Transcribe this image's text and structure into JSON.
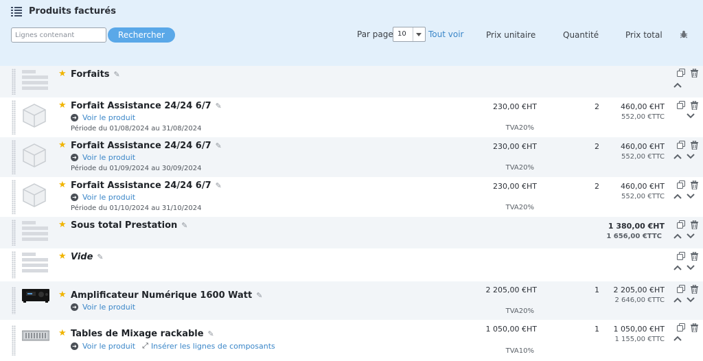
{
  "header": {
    "title": "Produits facturés",
    "search_placeholder": "Lignes contenant",
    "search_button": "Rechercher",
    "per_page_label": "Par page",
    "per_page_value": "10",
    "show_all": "Tout voir",
    "columns": {
      "unit_price": "Prix unitaire",
      "quantity": "Quantité",
      "total": "Prix total"
    }
  },
  "rows": [
    {
      "name": "Forfaits"
    },
    {
      "name": "Forfait Assistance 24/24 6/7",
      "link": "Voir le produit",
      "period": "Période du 01/08/2024 au 31/08/2024",
      "unit_price": "230,00 €HT",
      "tva": "TVA20%",
      "qty": "2",
      "total_ht": "460,00 €HT",
      "total_ttc": "552,00 €TTC"
    },
    {
      "name": "Forfait Assistance 24/24 6/7",
      "link": "Voir le produit",
      "period": "Période du 01/09/2024 au 30/09/2024",
      "unit_price": "230,00 €HT",
      "tva": "TVA20%",
      "qty": "2",
      "total_ht": "460,00 €HT",
      "total_ttc": "552,00 €TTC"
    },
    {
      "name": "Forfait Assistance 24/24 6/7",
      "link": "Voir le produit",
      "period": "Période du 01/10/2024 au 31/10/2024",
      "unit_price": "230,00 €HT",
      "tva": "TVA20%",
      "qty": "2",
      "total_ht": "460,00 €HT",
      "total_ttc": "552,00 €TTC"
    },
    {
      "name": "Sous total Prestation",
      "total_ht": "1 380,00 €HT",
      "total_ttc": "1 656,00 €TTC"
    },
    {
      "name": "Vide"
    },
    {
      "name": "Amplificateur Numérique 1600 Watt",
      "link": "Voir le produit",
      "unit_price": "2 205,00 €HT",
      "tva": "TVA20%",
      "qty": "1",
      "total_ht": "2 205,00 €HT",
      "total_ttc": "2 646,00 €TTC"
    },
    {
      "name": "Tables de Mixage rackable",
      "link": "Voir le produit",
      "insert_link": "Insérer les lignes de composants",
      "unit_price": "1 050,00 €HT",
      "tva": "TVA10%",
      "qty": "1",
      "total_ht": "1 050,00 €HT",
      "total_ttc": "1 155,00 €TTC"
    }
  ],
  "icons": {
    "title": "list-icon",
    "row_actions": [
      "duplicate-icon",
      "trash-icon",
      "chevron-up-icon",
      "chevron-down-icon"
    ],
    "edit": "pencil-icon",
    "favorite": "star-icon",
    "header_extra": "bug-icon"
  },
  "colors": {
    "header_bg": "#e3f0fb",
    "accent": "#5aa8e8",
    "link": "#3a86c8",
    "star": "#f0b400"
  }
}
